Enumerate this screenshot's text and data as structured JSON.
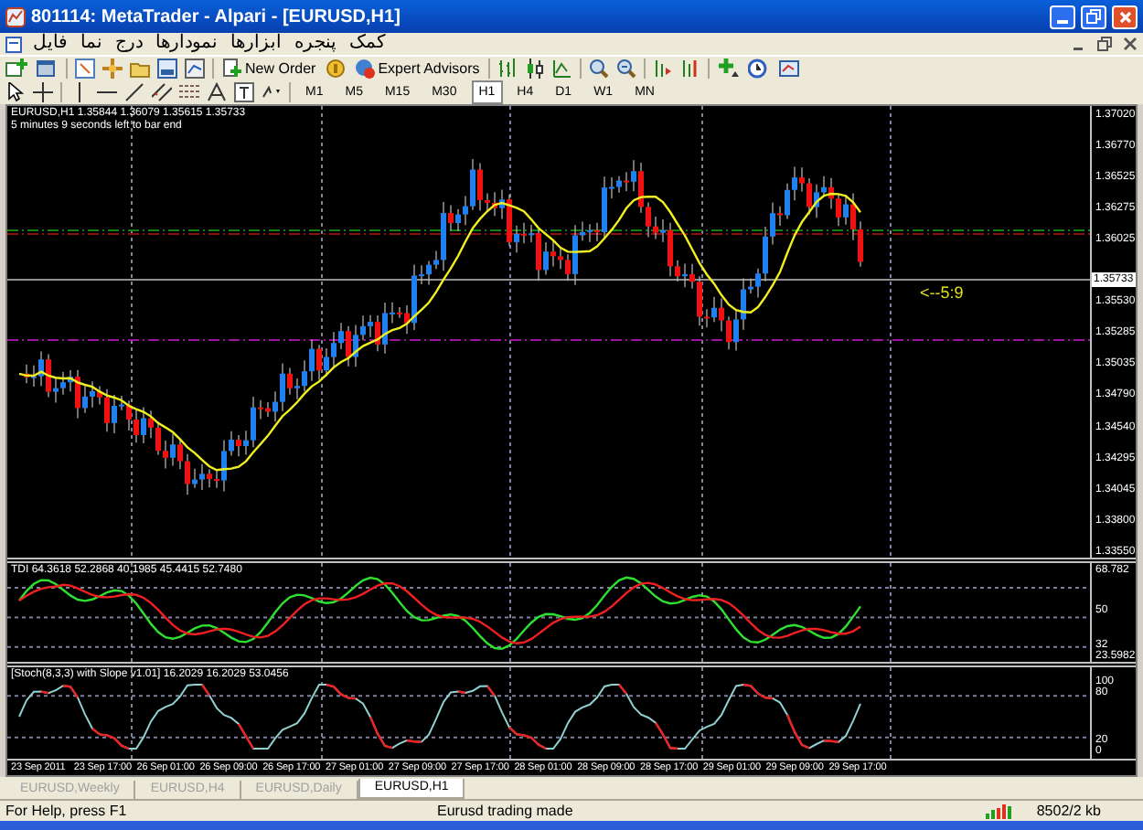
{
  "window": {
    "title": "801114: MetaTrader - Alpari - [EURUSD,H1]"
  },
  "menu": [
    "کمک",
    "پنجره",
    "ابزارها",
    "نمودارها",
    "درج",
    "نما",
    "فایل"
  ],
  "toolbar_buttons": [
    "New Order",
    "Expert Advisors"
  ],
  "timeframes": [
    {
      "label": "M1",
      "selected": false
    },
    {
      "label": "M5",
      "selected": false
    },
    {
      "label": "M15",
      "selected": false
    },
    {
      "label": "M30",
      "selected": false
    },
    {
      "label": "H1",
      "selected": true
    },
    {
      "label": "H4",
      "selected": false
    },
    {
      "label": "D1",
      "selected": false
    },
    {
      "label": "W1",
      "selected": false
    },
    {
      "label": "MN",
      "selected": false
    }
  ],
  "chart": {
    "header": "EURUSD,H1  1.35844 1.36079 1.35615 1.35733",
    "timer": "5 minutes 9 seconds left to bar end",
    "countdown_label": "<--5:9",
    "current_price": "1.35733",
    "price_axis": [
      "1.37020",
      "1.36770",
      "1.36525",
      "1.36275",
      "1.36025",
      "1.35530",
      "1.35285",
      "1.35035",
      "1.34790",
      "1.34540",
      "1.34295",
      "1.34045",
      "1.33800",
      "1.33550"
    ],
    "indicators": [
      {
        "title": "TDI 64.3618 52.2868 40.1985 45.4415 52.7480",
        "axis": [
          "68.782",
          "50",
          "32",
          "23.5982"
        ]
      },
      {
        "title": "[Stoch(8,3,3) with Slope v1.01] 16.2029 16.2029 53.0456",
        "axis": [
          "100",
          "80",
          "20",
          "0"
        ]
      }
    ],
    "time_axis": [
      "23 Sep 2011",
      "23 Sep 17:00",
      "26 Sep 01:00",
      "26 Sep 09:00",
      "26 Sep 17:00",
      "27 Sep 01:00",
      "27 Sep 09:00",
      "27 Sep 17:00",
      "28 Sep 01:00",
      "28 Sep 09:00",
      "28 Sep 17:00",
      "29 Sep 01:00",
      "29 Sep 09:00",
      "29 Sep 17:00"
    ]
  },
  "tabs": [
    {
      "label": "EURUSD,Weekly",
      "selected": false
    },
    {
      "label": "EURUSD,H4",
      "selected": false
    },
    {
      "label": "EURUSD,Daily",
      "selected": false
    },
    {
      "label": "EURUSD,H1",
      "selected": true
    }
  ],
  "status_bar": {
    "help": "For Help, press F1",
    "message": "Eurusd trading made",
    "traffic": "8502/2 kb"
  }
}
